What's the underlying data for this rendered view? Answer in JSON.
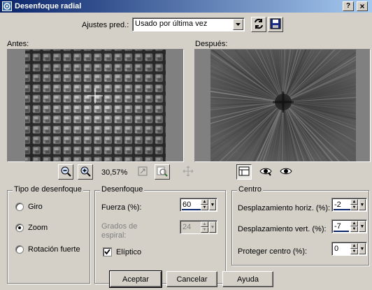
{
  "window": {
    "title": "Desenfoque radial",
    "help_glyph": "?",
    "close_glyph": "×"
  },
  "presets": {
    "label": "Ajustes pred.:",
    "selected": "Usado por última vez"
  },
  "before": {
    "label": "Antes:"
  },
  "after": {
    "label": "Después:"
  },
  "zoom": {
    "value": "30,57%"
  },
  "blur_type": {
    "title": "Tipo de desenfoque",
    "options": [
      "Giro",
      "Zoom",
      "Rotación fuerte"
    ],
    "selected": "Zoom"
  },
  "blur": {
    "title": "Desenfoque",
    "strength_label": "Fuerza (%):",
    "strength_value": "60",
    "spiral_label_1": "Grados de",
    "spiral_label_2": "espiral:",
    "spiral_value": "24",
    "elliptic_label": "Elíptico",
    "elliptic_checked": true
  },
  "center": {
    "title": "Centro",
    "h_label": "Desplazamiento horiz. (%):",
    "h_value": "-2",
    "v_label": "Desplazamiento vert. (%):",
    "v_value": "-7",
    "protect_label": "Proteger centro (%):",
    "protect_value": "0"
  },
  "buttons": {
    "ok": "Aceptar",
    "cancel": "Cancelar",
    "help": "Ayuda"
  },
  "icons": {
    "app": "blur-app-icon",
    "randomize": "randomize-icon",
    "save_preset": "save-icon",
    "zoom_out": "zoom-out-icon",
    "zoom_in": "zoom-in-icon",
    "fit": "fit-window-icon",
    "proof": "proof-icon",
    "pan": "pan-icon",
    "layout": "layout-toggle-icon",
    "show_original": "show-original-icon",
    "toggle_preview": "toggle-preview-icon"
  },
  "colors": {
    "titlebar_start": "#0a246a",
    "titlebar_end": "#a6caf0",
    "face": "#d4d0c8",
    "accent": "#0a246a"
  }
}
